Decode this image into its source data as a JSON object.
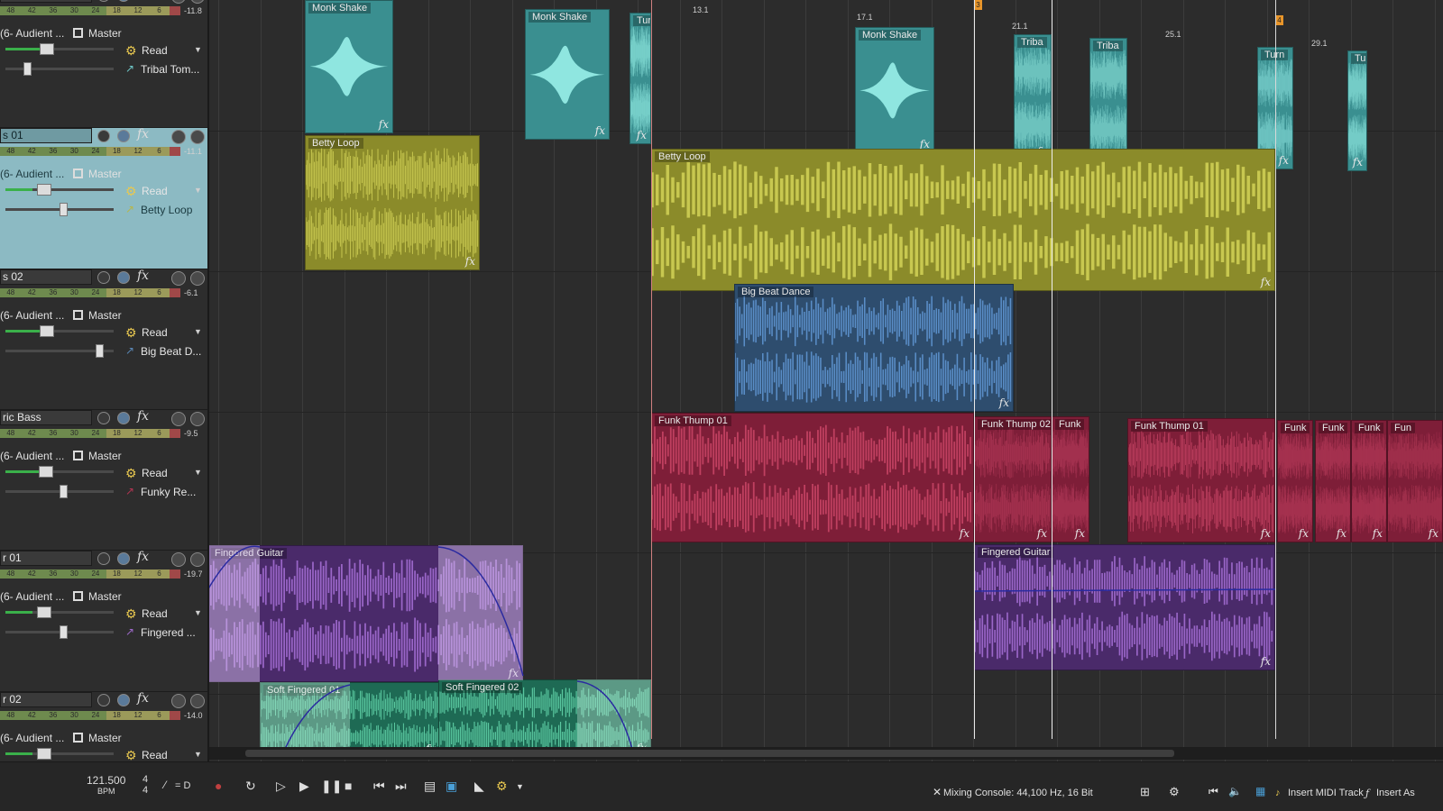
{
  "tracks": [
    {
      "name": "",
      "peak": "-11.8",
      "input": "(6- Audient ...",
      "output": "Master",
      "automation": "Read",
      "event": "Tribal Tom...",
      "color": "#6ec6c6",
      "selected": false
    },
    {
      "name": "s 01",
      "peak": "-11.1",
      "input": "(6- Audient ...",
      "output": "Master",
      "automation": "Read",
      "event": "Betty Loop",
      "color": "#b7b64a",
      "selected": true
    },
    {
      "name": "s 02",
      "peak": "-6.1",
      "input": "(6- Audient ...",
      "output": "Master",
      "automation": "Read",
      "event": "Big Beat D...",
      "color": "#5a86b4",
      "selected": false
    },
    {
      "name": "ric Bass",
      "peak": "-9.5",
      "input": "(6- Audient ...",
      "output": "Master",
      "automation": "Read",
      "event": "Funky Re...",
      "color": "#b03452",
      "selected": false
    },
    {
      "name": "r 01",
      "peak": "-19.7",
      "input": "(6- Audient ...",
      "output": "Master",
      "automation": "Read",
      "event": "Fingered ...",
      "color": "#9c68c8",
      "selected": false
    },
    {
      "name": "r 02",
      "peak": "-14.0",
      "input": "(6- Audient ...",
      "output": "Master",
      "automation": "Read",
      "event": "",
      "color": "#4aa888",
      "selected": false
    }
  ],
  "meter_scale": [
    "48",
    "42",
    "36",
    "30",
    "24",
    "18",
    "12",
    "6"
  ],
  "ruler": [
    "13.1",
    "17.1",
    "21.1",
    "25.1",
    "29.1"
  ],
  "markers": [
    "3",
    "4"
  ],
  "clips": {
    "monk1": "Monk Shake",
    "monk2": "Monk Shake",
    "monk3": "Monk Shake",
    "tur1": "Tur",
    "tribal1": "Triba",
    "tribal2": "Triba",
    "tur2": "Turn",
    "tur3": "Tur",
    "betty1": "Betty Loop",
    "betty2": "Betty Loop",
    "bigbeat": "Big Beat Dance",
    "funk1": "Funk Thump 01",
    "funk2": "Funk Thump 02",
    "funk3": "Funk",
    "funk4": "Funk Thump 01",
    "funk5": "Funk",
    "funk6": "Funk",
    "funk7": "Funk",
    "funk8": "Fun",
    "guitar1": "Fingered Guitar",
    "guitar2": "Fingered Guitar",
    "soft1": "Soft Fingered 01",
    "soft2": "Soft Fingered 02",
    "fx": "fx"
  },
  "transport": {
    "bpm": "121.500",
    "bpm_label": "BPM",
    "ts_top": "4",
    "ts_bottom": "4",
    "snap": "= D",
    "status": "Mixing Console: 44,100 Hz, 16 Bit",
    "insert_midi": "Insert MIDI Track",
    "insert_audio": "Insert As"
  }
}
